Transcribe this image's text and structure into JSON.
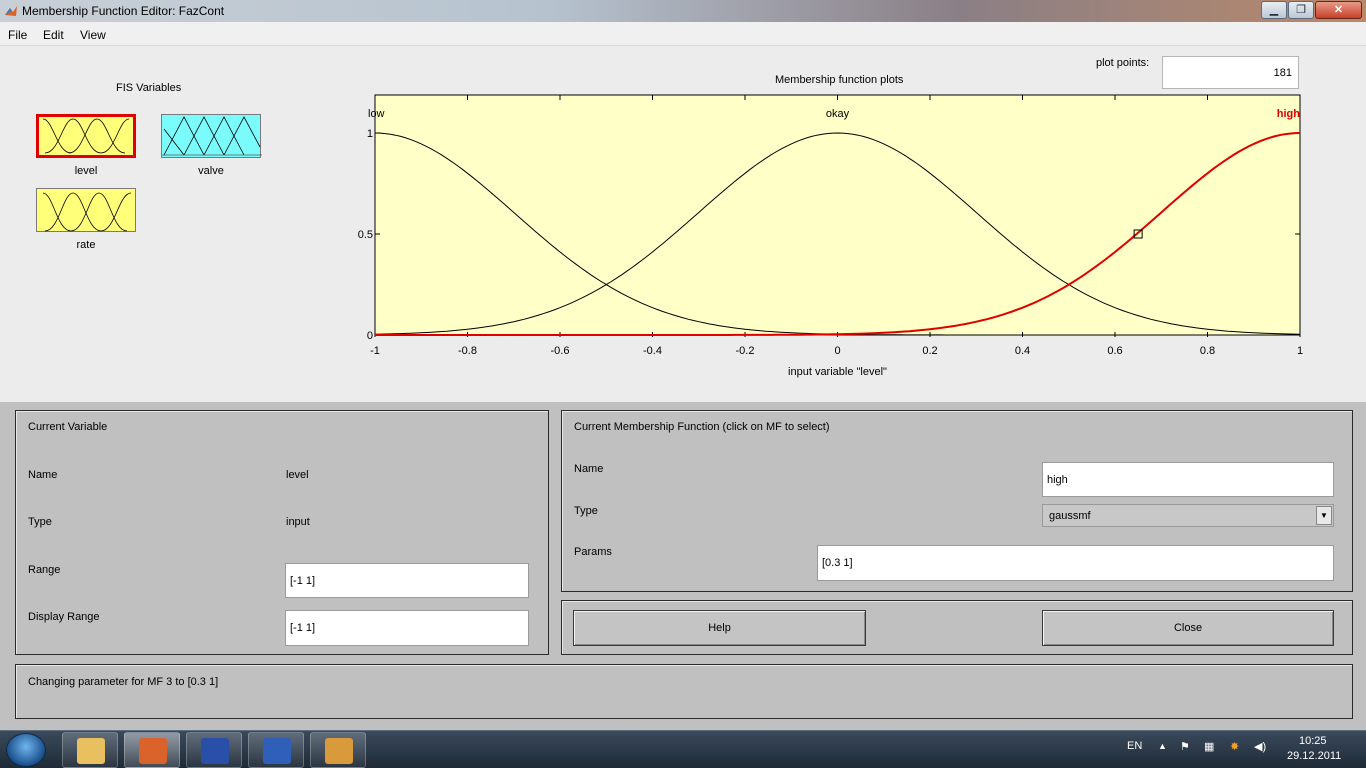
{
  "window": {
    "title": "Membership Function Editor: FazCont",
    "controls": {
      "minimize": "▁",
      "maximize": "❐",
      "close": "✕"
    }
  },
  "menu": {
    "file": "File",
    "edit": "Edit",
    "view": "View"
  },
  "fis": {
    "heading": "FIS Variables",
    "variables": [
      {
        "name": "level",
        "kind": "input",
        "color": "#ffff7a",
        "selected": true
      },
      {
        "name": "valve",
        "kind": "output",
        "color": "#7afcfc",
        "selected": false
      },
      {
        "name": "rate",
        "kind": "input",
        "color": "#ffff7a",
        "selected": false
      }
    ]
  },
  "plot": {
    "title": "Membership function plots",
    "plot_points_label": "plot points:",
    "plot_points_value": "181"
  },
  "chart_data": {
    "type": "line",
    "title": "Membership function plots",
    "xlabel": "input variable \"level\"",
    "ylabel": "",
    "xlim": [
      -1,
      1
    ],
    "ylim": [
      0,
      1
    ],
    "x_ticks": [
      "-1",
      "-0.8",
      "-0.6",
      "-0.4",
      "-0.2",
      "0",
      "0.2",
      "0.4",
      "0.6",
      "0.8",
      "1"
    ],
    "y_ticks": [
      "0",
      "0.5",
      "1"
    ],
    "background": "#ffffc8",
    "series": [
      {
        "name": "low",
        "function": "gaussmf",
        "sigma": 0.3,
        "center": -1,
        "color": "#000000",
        "selected": false
      },
      {
        "name": "okay",
        "function": "gaussmf",
        "sigma": 0.3,
        "center": 0,
        "color": "#000000",
        "selected": false
      },
      {
        "name": "high",
        "function": "gaussmf",
        "sigma": 0.3,
        "center": 1,
        "color": "#e00000",
        "selected": true
      }
    ],
    "marker_point": {
      "x": 0.65,
      "y": 0.5
    }
  },
  "current_variable": {
    "heading": "Current Variable",
    "name_label": "Name",
    "name_value": "level",
    "type_label": "Type",
    "type_value": "input",
    "range_label": "Range",
    "range_value": "[-1 1]",
    "display_range_label": "Display Range",
    "display_range_value": "[-1 1]"
  },
  "current_mf": {
    "heading": "Current Membership Function (click on MF to select)",
    "name_label": "Name",
    "name_value": "high",
    "type_label": "Type",
    "type_value": "gaussmf",
    "params_label": "Params",
    "params_value": "[0.3 1]"
  },
  "buttons": {
    "help": "Help",
    "close": "Close"
  },
  "status": {
    "message": "Changing parameter for MF 3 to  [0.3 1]"
  },
  "taskbar": {
    "language": "EN",
    "time": "10:25",
    "date": "29.12.2011",
    "apps": [
      {
        "name": "explorer",
        "color": "#e8c060"
      },
      {
        "name": "matlab",
        "color": "#d9632a",
        "active": true
      },
      {
        "name": "save",
        "color": "#2a4fa8"
      },
      {
        "name": "word",
        "color": "#2f5fb8"
      },
      {
        "name": "archive",
        "color": "#d89a3a"
      }
    ]
  }
}
